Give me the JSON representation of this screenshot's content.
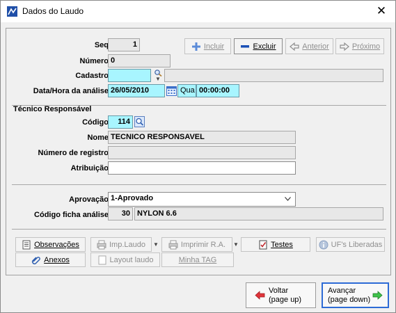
{
  "window": {
    "title": "Dados do Laudo",
    "close_glyph": "✕"
  },
  "form": {
    "seq": {
      "label": "Seq",
      "value": "1"
    },
    "numero": {
      "label": "Número",
      "value": "0"
    },
    "cadastro": {
      "label": "Cadastro",
      "value": "",
      "desc": ""
    },
    "data_hora": {
      "label": "Data/Hora da análise",
      "date": "26/05/2010",
      "weekday": "Qua",
      "time": "00:00:00"
    }
  },
  "toolbar": {
    "incluir": "Incluir",
    "excluir": "Excluir",
    "anterior": "Anterior",
    "proximo": "Próximo"
  },
  "tecnico": {
    "section": "Técnico Responsável",
    "codigo": {
      "label": "Código",
      "value": "114"
    },
    "nome": {
      "label": "Nome",
      "value": "TECNICO RESPONSAVEL"
    },
    "registro": {
      "label": "Número de registro",
      "value": ""
    },
    "atribuicao": {
      "label": "Atribuição",
      "value": ""
    }
  },
  "aprovacao": {
    "label": "Aprovação",
    "value": "1-Aprovado",
    "options": [
      "1-Aprovado"
    ]
  },
  "ficha": {
    "label": "Código ficha análise",
    "code": "30",
    "desc": "NYLON 6.6"
  },
  "actions": {
    "observacoes": "Observações",
    "imp_laudo": "Imp.Laudo",
    "imprimir_ra": "Imprimir R.A.",
    "testes": "Testes",
    "ufs": "UF's Liberadas",
    "anexos": "Anexos",
    "layout_laudo": "Layout laudo",
    "minha_tag": "Minha TAG"
  },
  "nav": {
    "voltar_line1": "Voltar",
    "voltar_line2": "(page up)",
    "avancar_line1": "Avançar",
    "avancar_line2": "(page down)"
  },
  "colors": {
    "field_highlight": "#a8f5ff",
    "accent_blue": "#2d6bd6"
  }
}
